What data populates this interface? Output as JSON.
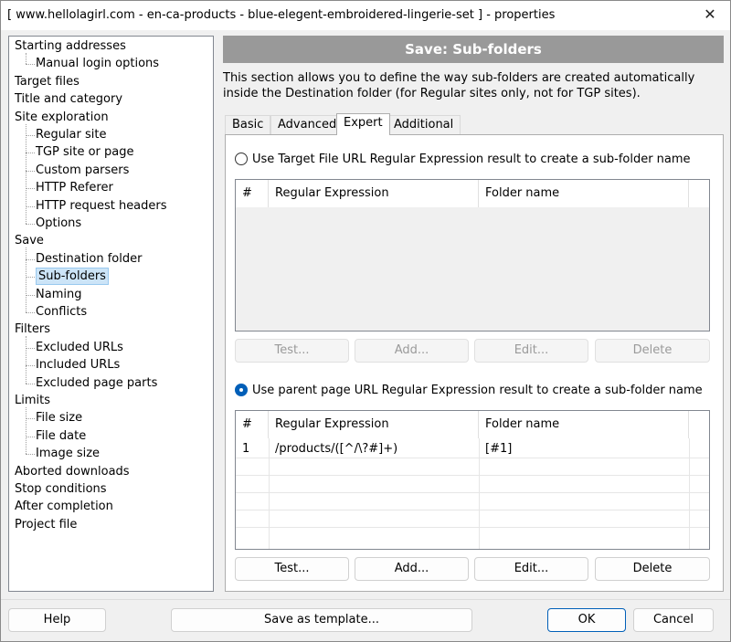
{
  "window": {
    "title": "[ www.hellolagirl.com - en-ca-products - blue-elegent-embroidered-lingerie-set ] - properties",
    "close_glyph": "✕"
  },
  "tree": {
    "items": [
      {
        "label": "Starting addresses",
        "level": 0
      },
      {
        "label": "Manual login options",
        "level": 1
      },
      {
        "label": "Target files",
        "level": 0
      },
      {
        "label": "Title and category",
        "level": 0
      },
      {
        "label": "Site exploration",
        "level": 0
      },
      {
        "label": "Regular site",
        "level": 1
      },
      {
        "label": "TGP site or page",
        "level": 1
      },
      {
        "label": "Custom parsers",
        "level": 1
      },
      {
        "label": "HTTP Referer",
        "level": 1
      },
      {
        "label": "HTTP request headers",
        "level": 1
      },
      {
        "label": "Options",
        "level": 1
      },
      {
        "label": "Save",
        "level": 0
      },
      {
        "label": "Destination folder",
        "level": 1
      },
      {
        "label": "Sub-folders",
        "level": 1,
        "selected": true
      },
      {
        "label": "Naming",
        "level": 1
      },
      {
        "label": "Conflicts",
        "level": 1
      },
      {
        "label": "Filters",
        "level": 0
      },
      {
        "label": "Excluded URLs",
        "level": 1
      },
      {
        "label": "Included URLs",
        "level": 1
      },
      {
        "label": "Excluded page parts",
        "level": 1
      },
      {
        "label": "Limits",
        "level": 0
      },
      {
        "label": "File size",
        "level": 1
      },
      {
        "label": "File date",
        "level": 1
      },
      {
        "label": "Image size",
        "level": 1
      },
      {
        "label": "Aborted downloads",
        "level": 0
      },
      {
        "label": "Stop conditions",
        "level": 0
      },
      {
        "label": "After completion",
        "level": 0
      },
      {
        "label": "Project file",
        "level": 0
      }
    ]
  },
  "panel": {
    "header": "Save: Sub-folders",
    "description": "This section allows you to define the way sub-folders are created automatically inside the Destination folder (for Regular sites only, not for TGP sites).",
    "tabs": [
      "Basic",
      "Advanced",
      "Expert",
      "Additional"
    ],
    "active_tab": "Expert"
  },
  "target_section": {
    "radio_label": "Use Target File URL Regular Expression result to create a sub-folder name",
    "selected": false,
    "columns": [
      "#",
      "Regular Expression",
      "Folder name"
    ],
    "rows": [],
    "buttons": {
      "test": "Test...",
      "add": "Add...",
      "edit": "Edit...",
      "delete": "Delete"
    },
    "buttons_enabled": false
  },
  "parent_section": {
    "radio_label": "Use parent page URL Regular Expression result to create a sub-folder name",
    "selected": true,
    "columns": [
      "#",
      "Regular Expression",
      "Folder name"
    ],
    "rows": [
      {
        "num": "1",
        "regex": "/products/([^/\\?#]+)",
        "folder": "[#1]"
      }
    ],
    "buttons": {
      "test": "Test...",
      "add": "Add...",
      "edit": "Edit...",
      "delete": "Delete"
    },
    "buttons_enabled": true
  },
  "footer": {
    "help": "Help",
    "save_template": "Save as template...",
    "ok": "OK",
    "cancel": "Cancel"
  },
  "colors": {
    "header_bar": "#999999",
    "selection": "#cce4f7",
    "accent": "#005fb8"
  }
}
